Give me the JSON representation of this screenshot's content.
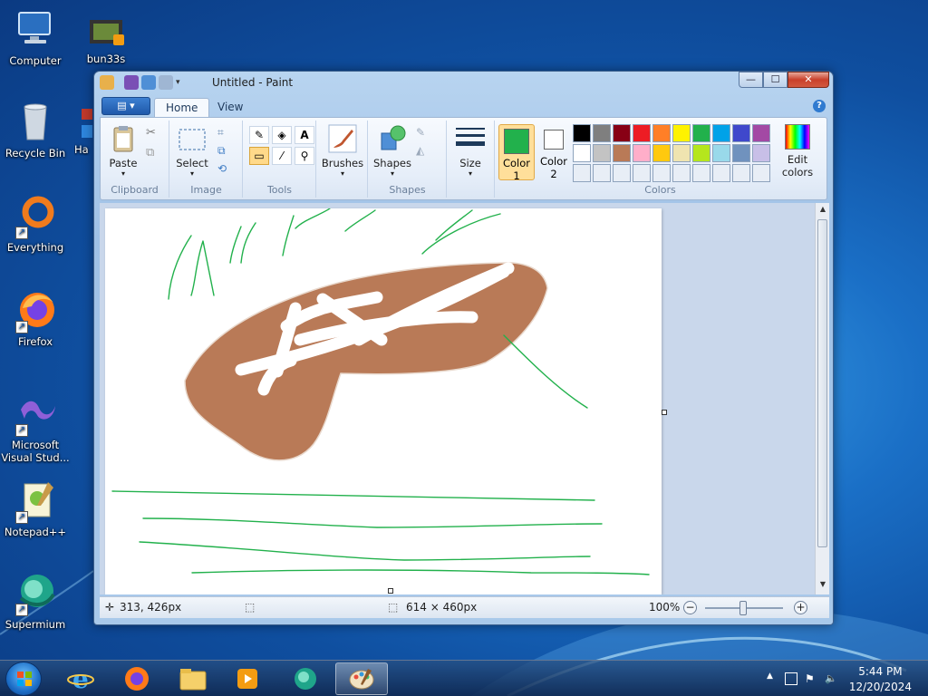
{
  "desktop": {
    "icons": [
      {
        "label": "Computer"
      },
      {
        "label": "bun33s"
      },
      {
        "label": "Recycle Bin"
      },
      {
        "label": "Ha"
      },
      {
        "label": "Everything"
      },
      {
        "label": "Firefox"
      },
      {
        "label": "Microsoft Visual Stud..."
      },
      {
        "label": "Notepad++"
      },
      {
        "label": "Supermium"
      }
    ]
  },
  "window": {
    "title": "Untitled - Paint",
    "buttons": {
      "minimize": "—",
      "maximize": "☐",
      "close": "✕"
    }
  },
  "ribbon": {
    "tabs": [
      {
        "label": "Home",
        "active": true
      },
      {
        "label": "View",
        "active": false
      }
    ],
    "groups": {
      "clipboard": {
        "label": "Clipboard",
        "paste": "Paste"
      },
      "image": {
        "label": "Image",
        "select": "Select"
      },
      "tools": {
        "label": "Tools"
      },
      "brushes": {
        "label": "Brushes"
      },
      "shapes": {
        "label": "Shapes",
        "shapes_btn": "Shapes"
      },
      "size": {
        "label": "Size"
      },
      "colors": {
        "label": "Colors",
        "color1": {
          "line1": "Color",
          "line2": "1",
          "value": "#22b14c"
        },
        "color2": {
          "line1": "Color",
          "line2": "2",
          "value": "#ffffff"
        },
        "edit_colors": {
          "line1": "Edit",
          "line2": "colors"
        },
        "palette_row1": [
          "#000000",
          "#7f7f7f",
          "#880015",
          "#ed1c24",
          "#ff7f27",
          "#fff200",
          "#22b14c",
          "#00a2e8",
          "#3f48cc",
          "#a349a4"
        ],
        "palette_row2": [
          "#ffffff",
          "#c3c3c3",
          "#b97a57",
          "#ffaec9",
          "#ffc90e",
          "#efe4b0",
          "#b5e61d",
          "#99d9ea",
          "#7092be",
          "#c8bfe7"
        ],
        "palette_row3": [
          "#e8eef6",
          "#e8eef6",
          "#e8eef6",
          "#e8eef6",
          "#e8eef6",
          "#e8eef6",
          "#e8eef6",
          "#e8eef6",
          "#e8eef6",
          "#e8eef6"
        ]
      }
    }
  },
  "canvas": {
    "stroke_color_green": "#22b14c",
    "fill_color_brown": "#b97a57"
  },
  "statusbar": {
    "cursor_pos": "313, 426px",
    "image_size": "614 × 460px",
    "zoom": "100%"
  },
  "taskbar": {
    "apps": [
      "internet-explorer",
      "firefox",
      "file-explorer",
      "media-player",
      "supermium",
      "paint"
    ],
    "clock": {
      "time": "5:44 PM",
      "date": "12/20/2024"
    }
  }
}
